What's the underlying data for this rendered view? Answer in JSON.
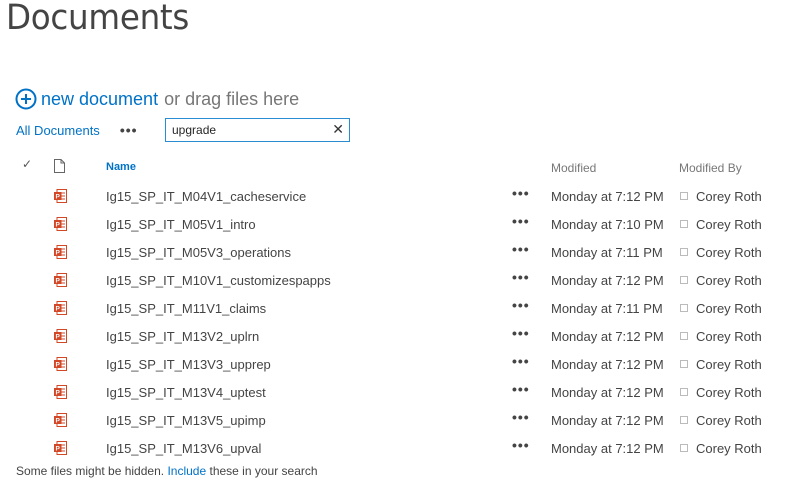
{
  "page_title": "Documents",
  "new_document": {
    "link_label": "new document",
    "rest_label": "or drag files here",
    "icon": "plus-circle-icon"
  },
  "views": {
    "current_view": "All Documents",
    "more_label": "•••"
  },
  "search": {
    "value": "upgrade",
    "clear_icon": "close-icon"
  },
  "columns": {
    "select_icon": "check-icon",
    "type_icon": "document-icon",
    "name": "Name",
    "modified": "Modified",
    "modified_by": "Modified By"
  },
  "documents": [
    {
      "name": "Ig15_SP_IT_M04V1_cacheservice",
      "more": "•••",
      "modified": "Monday at 7:12 PM",
      "modified_by": "Corey Roth"
    },
    {
      "name": "Ig15_SP_IT_M05V1_intro",
      "more": "•••",
      "modified": "Monday at 7:10 PM",
      "modified_by": "Corey Roth"
    },
    {
      "name": "Ig15_SP_IT_M05V3_operations",
      "more": "•••",
      "modified": "Monday at 7:11 PM",
      "modified_by": "Corey Roth"
    },
    {
      "name": "Ig15_SP_IT_M10V1_customizespapps",
      "more": "•••",
      "modified": "Monday at 7:12 PM",
      "modified_by": "Corey Roth"
    },
    {
      "name": "Ig15_SP_IT_M11V1_claims",
      "more": "•••",
      "modified": "Monday at 7:11 PM",
      "modified_by": "Corey Roth"
    },
    {
      "name": "Ig15_SP_IT_M13V2_uplrn",
      "more": "•••",
      "modified": "Monday at 7:12 PM",
      "modified_by": "Corey Roth"
    },
    {
      "name": "Ig15_SP_IT_M13V3_upprep",
      "more": "•••",
      "modified": "Monday at 7:12 PM",
      "modified_by": "Corey Roth"
    },
    {
      "name": "Ig15_SP_IT_M13V4_uptest",
      "more": "•••",
      "modified": "Monday at 7:12 PM",
      "modified_by": "Corey Roth"
    },
    {
      "name": "Ig15_SP_IT_M13V5_upimp",
      "more": "•••",
      "modified": "Monday at 7:12 PM",
      "modified_by": "Corey Roth"
    },
    {
      "name": "Ig15_SP_IT_M13V6_upval",
      "more": "•••",
      "modified": "Monday at 7:12 PM",
      "modified_by": "Corey Roth"
    }
  ],
  "footer": {
    "before": "Some files might be hidden.",
    "link": "Include",
    "after": "these in your search"
  },
  "colors": {
    "link": "#0072c6",
    "text": "#444444",
    "ppt_icon": "#d24726",
    "search_border": "#2a8dd4"
  }
}
